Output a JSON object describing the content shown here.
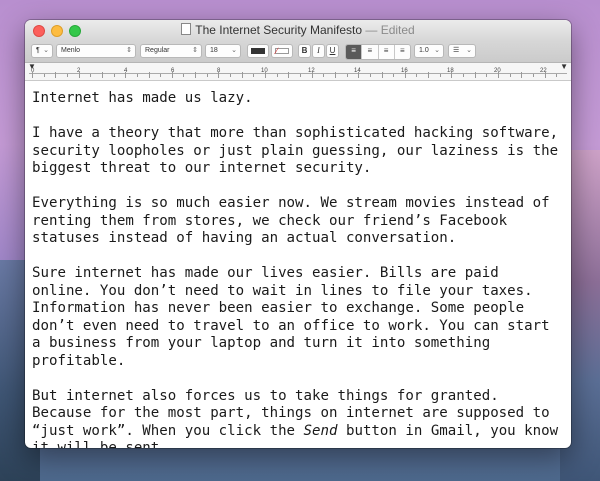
{
  "window": {
    "title": "The Internet Security Manifesto",
    "status": "— Edited"
  },
  "toolbar": {
    "paragraph_style": "¶",
    "font_family": "Menlo",
    "font_style": "Regular",
    "font_size": "18",
    "bold": "B",
    "italic": "I",
    "underline": "U",
    "line_spacing": "1.0",
    "list_style": "☰",
    "text_color": "#333333",
    "align_options": [
      "≡",
      "≡",
      "≡",
      "≡"
    ],
    "active_align": 0
  },
  "ruler": {
    "numbers": [
      "0",
      "2",
      "4",
      "6",
      "8",
      "10",
      "12",
      "14",
      "16",
      "18",
      "20",
      "22"
    ]
  },
  "document": {
    "p1": "Internet has made us lazy.",
    "p2": "I have a theory that more than sophisticated hacking software, security loopholes or just plain guessing, our laziness is the biggest threat to our internet security.",
    "p3": "Everything is so much easier now. We stream movies instead of renting them from stores, we check our friend’s Facebook statuses instead of having an actual conversation.",
    "p4": "Sure internet has made our lives easier. Bills are paid online. You don’t need to wait in lines to file your taxes. Information has never been easier to exchange. Some people don’t even need to travel to an office to work. You can start a business from your laptop and turn it into something profitable.",
    "p5_before": "But internet also forces us to take things for granted. Because for the most part, things on internet are supposed to “just work”. When you click the ",
    "p5_em": "Send",
    "p5_after": " button in Gmail, you know it will be sent."
  }
}
